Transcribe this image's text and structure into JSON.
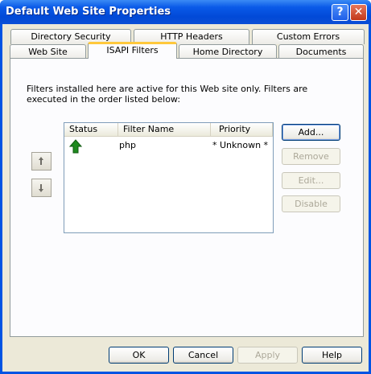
{
  "window": {
    "title": "Default Web Site Properties",
    "help_glyph": "?",
    "close_glyph": "✕"
  },
  "tabs_row_back": [
    {
      "label": "Directory Security"
    },
    {
      "label": "HTTP Headers"
    },
    {
      "label": "Custom Errors"
    }
  ],
  "tabs_row_front": [
    {
      "label": "Web Site"
    },
    {
      "label": "ISAPI Filters",
      "active": true
    },
    {
      "label": "Home Directory"
    },
    {
      "label": "Documents"
    }
  ],
  "isapi": {
    "description": "Filters installed here are active for this Web site only. Filters are executed in the order listed below:",
    "columns": {
      "status": "Status",
      "filter_name": "Filter Name",
      "priority": "Priority"
    },
    "filters": [
      {
        "status_icon": "green-up-arrow-icon",
        "name": "php",
        "priority": "* Unknown *"
      }
    ],
    "buttons": {
      "add": "Add...",
      "remove": "Remove",
      "edit": "Edit...",
      "disable": "Disable"
    }
  },
  "footer": {
    "ok": "OK",
    "cancel": "Cancel",
    "apply": "Apply",
    "help": "Help"
  },
  "colors": {
    "titlebar": "#0a5ae8",
    "active_tab_accent": "#ffc83c",
    "status_arrow": "#1f8a1f",
    "dialog_bg": "#ece9d8"
  }
}
